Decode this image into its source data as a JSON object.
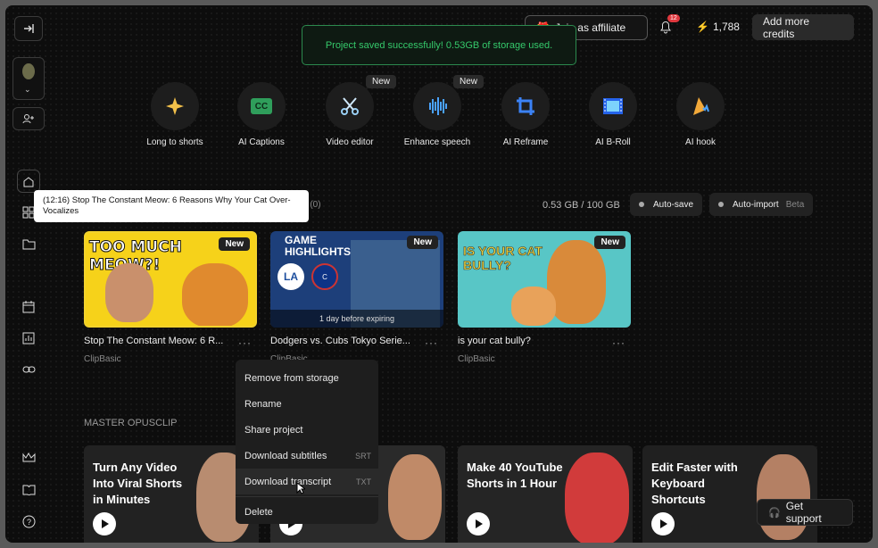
{
  "toast": "Project saved successfully! 0.53GB of storage used.",
  "header": {
    "affiliate": "Join as affiliate",
    "notif_count": "12",
    "credits": "1,788",
    "add_credits": "Add more credits"
  },
  "tools": [
    {
      "label": "Long to shorts",
      "icon": "sparkle-icon",
      "badge": ""
    },
    {
      "label": "AI Captions",
      "icon": "cc-icon",
      "badge": ""
    },
    {
      "label": "Video editor",
      "icon": "scissors-icon",
      "badge": "New"
    },
    {
      "label": "Enhance speech",
      "icon": "waveform-icon",
      "badge": "New"
    },
    {
      "label": "AI Reframe",
      "icon": "crop-icon",
      "badge": ""
    },
    {
      "label": "AI B-Roll",
      "icon": "film-icon",
      "badge": ""
    },
    {
      "label": "AI hook",
      "icon": "hook-icon",
      "badge": ""
    }
  ],
  "tooltip": "(12:16) Stop The Constant Meow: 6 Reasons Why Your Cat Over-Vocalizes",
  "projects_tab_fragment": "ps (0)",
  "storage": {
    "usage": "0.53 GB / 100 GB",
    "autosave": "Auto-save",
    "autoimport": "Auto-import",
    "beta": "Beta"
  },
  "cards": [
    {
      "title": "Stop The Constant Meow: 6 R...",
      "sub": "ClipBasic",
      "tag": "New",
      "overlay": "TOO MUCH MEOW?!",
      "expire": ""
    },
    {
      "title": "Dodgers vs. Cubs Tokyo Serie...",
      "sub": "ClipBasic",
      "tag": "New",
      "overlay": "GAME HIGHLIGHTS",
      "expire": "1 day before expiring"
    },
    {
      "title": "is your cat bully?",
      "sub": "ClipBasic",
      "tag": "New",
      "overlay": "IS YOUR CAT BULLY?",
      "expire": ""
    }
  ],
  "menu": [
    {
      "label": "Remove from storage",
      "key": ""
    },
    {
      "label": "Rename",
      "key": ""
    },
    {
      "label": "Share project",
      "key": ""
    },
    {
      "label": "Download subtitles",
      "key": "SRT"
    },
    {
      "label": "Download transcript",
      "key": "TXT"
    },
    {
      "label": "Delete",
      "key": ""
    }
  ],
  "master": {
    "heading": "MASTER OPUSCLIP",
    "cards": [
      {
        "title": "Turn Any Video Into Viral Shorts in Minutes"
      },
      {
        "title": ""
      },
      {
        "title": "Make 40 YouTube Shorts in 1 Hour"
      },
      {
        "title": "Edit Faster with Keyboard Shortcuts"
      }
    ]
  },
  "support": "Get support",
  "colors": {
    "accent_green": "#2c8a4e",
    "toast_text": "#35c96b"
  }
}
